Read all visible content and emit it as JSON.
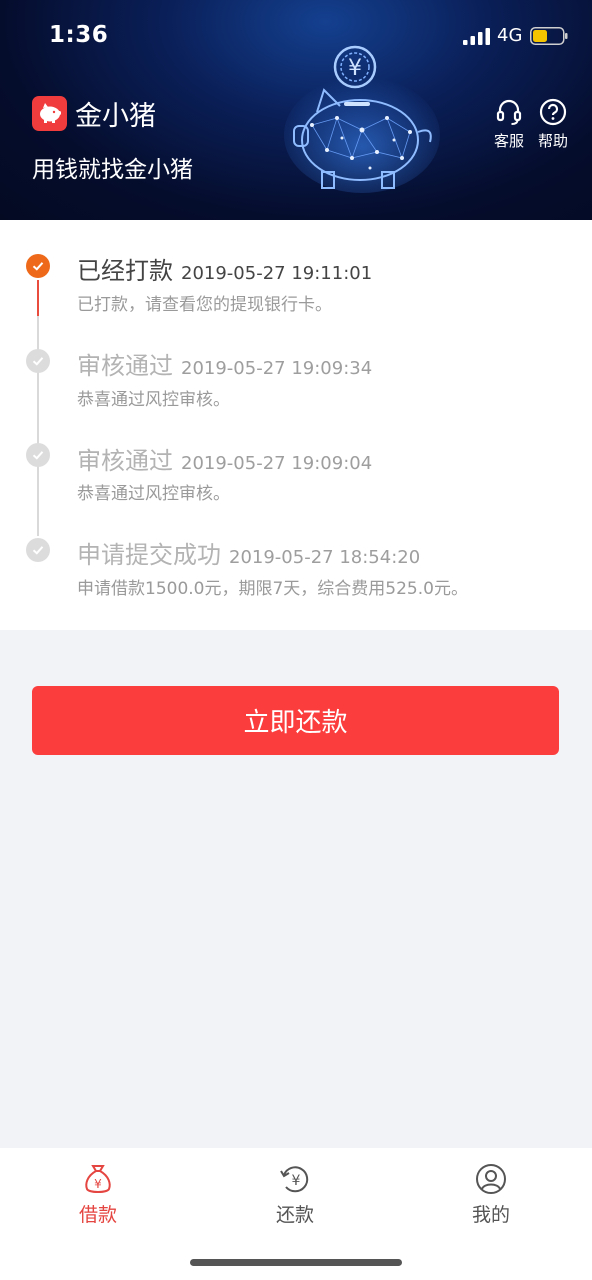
{
  "status_bar": {
    "time": "1:36",
    "network": "4G",
    "battery_color": "#f5c400"
  },
  "header": {
    "brand_name": "金小猪",
    "slogan": "用钱就找金小猪",
    "actions": [
      {
        "label": "客服",
        "icon": "headset-icon"
      },
      {
        "label": "帮助",
        "icon": "help-icon"
      }
    ],
    "bg_color": "#050d2d"
  },
  "timeline": {
    "active_color": "#ee6a1a",
    "items": [
      {
        "title": "已经打款",
        "time": "2019-05-27 19:11:01",
        "desc": "已打款，请查看您的提现银行卡。",
        "state": "active"
      },
      {
        "title": "审核通过",
        "time": "2019-05-27 19:09:34",
        "desc": "恭喜通过风控审核。",
        "state": "done"
      },
      {
        "title": "审核通过",
        "time": "2019-05-27 19:09:04",
        "desc": "恭喜通过风控审核。",
        "state": "done"
      },
      {
        "title": "申请提交成功",
        "time": "2019-05-27 18:54:20",
        "desc": "申请借款1500.0元，期限7天，综合费用525.0元。",
        "state": "done"
      }
    ]
  },
  "repay_button": {
    "label": "立即还款",
    "color": "#fc3d3d"
  },
  "tabbar": {
    "active_color": "#e54540",
    "tabs": [
      {
        "label": "借款",
        "icon": "money-bag-icon",
        "active": true
      },
      {
        "label": "还款",
        "icon": "repay-yen-icon",
        "active": false
      },
      {
        "label": "我的",
        "icon": "user-icon",
        "active": false
      }
    ]
  }
}
